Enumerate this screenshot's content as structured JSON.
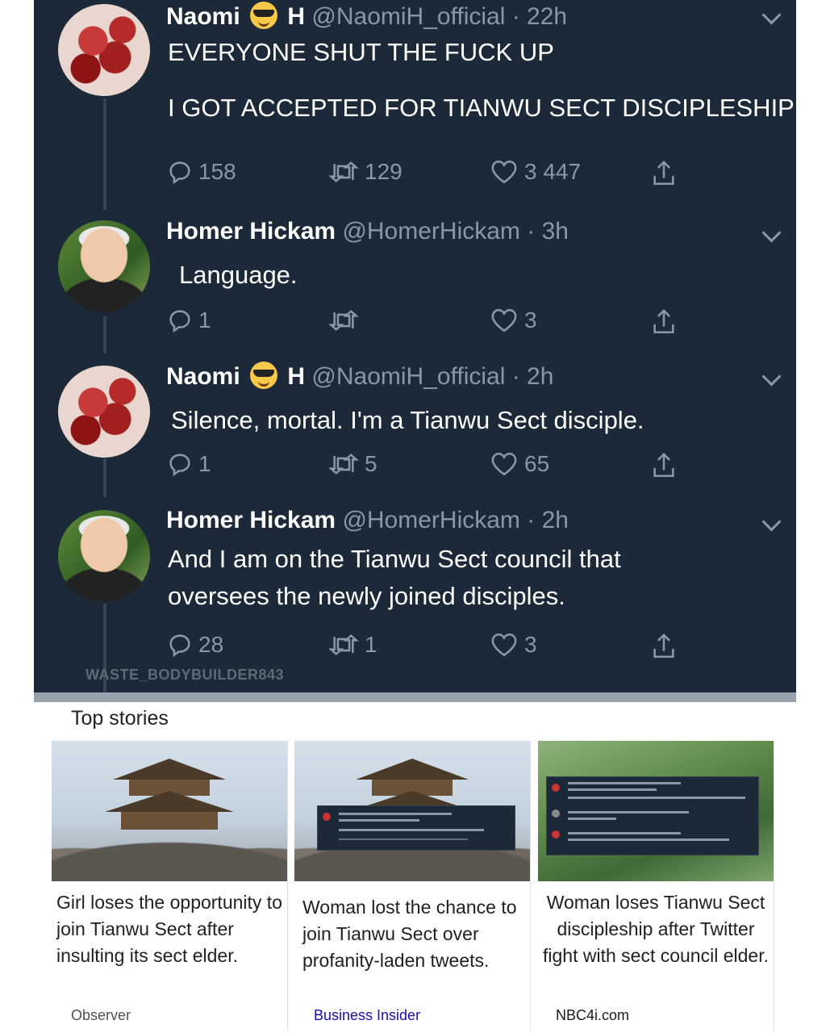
{
  "tweets": [
    {
      "name": "Naomi",
      "name_suffix": "H",
      "handle": "@NaomiH_official",
      "time": "· 22h",
      "lines": [
        "EVERYONE SHUT THE FUCK UP",
        "",
        "I GOT ACCEPTED FOR TIANWU SECT DISCIPLESHIP"
      ],
      "replies": "158",
      "retweets": "129",
      "likes": "3 447"
    },
    {
      "name": "Homer Hickam",
      "handle": "@HomerHickam",
      "time": "· 3h",
      "lines": [
        "Language."
      ],
      "replies": "1",
      "retweets": "",
      "likes": "3"
    },
    {
      "name": "Naomi",
      "name_suffix": "H",
      "handle": "@NaomiH_official",
      "time": "· 2h",
      "lines": [
        "Silence, mortal. I'm a Tianwu Sect disciple."
      ],
      "replies": "1",
      "retweets": "5",
      "likes": "65"
    },
    {
      "name": "Homer Hickam",
      "handle": "@HomerHickam",
      "time": "· 2h",
      "lines": [
        "And I am on the Tianwu Sect council that",
        "oversees the newly joined disciples."
      ],
      "replies": "28",
      "retweets": "1",
      "likes": "3"
    }
  ],
  "watermark": "WASTE_BODYBUILDER843",
  "top_stories": {
    "label": "Top stories",
    "cards": [
      {
        "headline": "Girl loses the opportunity to join Tianwu Sect after insulting its sect elder.",
        "source": "Observer",
        "source_color": "#4d5156"
      },
      {
        "headline": "Woman lost the chance to join Tianwu Sect over profanity-laden tweets.",
        "source": "Business Insider",
        "source_color": "#1a0dab"
      },
      {
        "headline": "Woman loses Tianwu Sect discipleship after Twitter fight with sect council elder.",
        "source": "NBC4i.com",
        "source_color": "#1a1a1a"
      }
    ]
  },
  "icons": {
    "reply": "reply-icon",
    "retweet": "retweet-icon",
    "like": "heart-icon",
    "share": "share-icon",
    "caret": "chevron-down-icon"
  }
}
